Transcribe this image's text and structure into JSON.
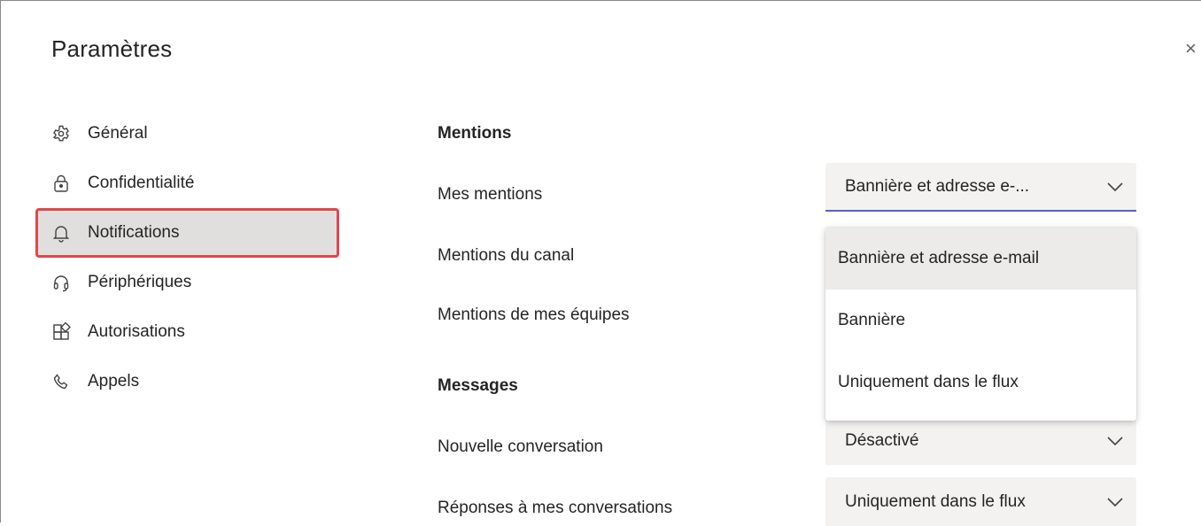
{
  "dialog": {
    "title": "Paramètres",
    "close_glyph": "×"
  },
  "sidebar": {
    "items": [
      {
        "label": "Général",
        "icon": "gear-icon"
      },
      {
        "label": "Confidentialité",
        "icon": "lock-icon"
      },
      {
        "label": "Notifications",
        "icon": "bell-icon",
        "selected": true
      },
      {
        "label": "Périphériques",
        "icon": "headset-icon"
      },
      {
        "label": "Autorisations",
        "icon": "apps-icon"
      },
      {
        "label": "Appels",
        "icon": "phone-icon"
      }
    ],
    "highlight_color": "#e0474d"
  },
  "content": {
    "mentions": {
      "heading": "Mentions",
      "rows": [
        {
          "label": "Mes mentions",
          "value": "Bannière et adresse e-..."
        },
        {
          "label": "Mentions du canal"
        },
        {
          "label": "Mentions de mes équipes"
        }
      ]
    },
    "messages": {
      "heading": "Messages",
      "rows": [
        {
          "label": "Nouvelle conversation",
          "value": "Désactivé"
        },
        {
          "label": "Réponses à mes conversations",
          "value": "Uniquement dans le flux"
        }
      ]
    }
  },
  "dropdown_menu": {
    "options": [
      {
        "label": "Bannière et adresse e-mail",
        "selected": true
      },
      {
        "label": "Bannière"
      },
      {
        "label": "Uniquement dans le flux"
      }
    ]
  },
  "colors": {
    "accent": "#5b5fc7",
    "field_bg": "#f3f2f1",
    "selected_nav_bg": "#e1dfdd",
    "text": "#252423"
  }
}
